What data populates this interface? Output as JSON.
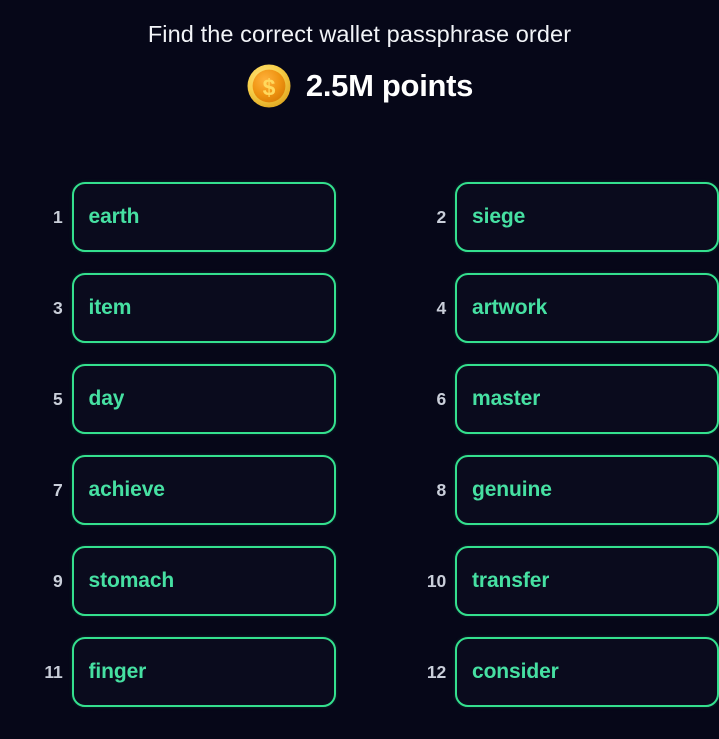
{
  "theme": {
    "background": "#060718",
    "box_border": "#34e08e",
    "box_fill": "#0a0b1d",
    "word_color": "#46e0a2",
    "index_color": "#c9ced9",
    "title_color": "#f2f4f8",
    "coin_outer": "#f7cf4a",
    "coin_inner": "#ef9412"
  },
  "header": {
    "title": "Find the correct wallet passphrase order",
    "coin_icon": "gold-coin-dollar-icon",
    "points": "2.5M points"
  },
  "grid": {
    "rows": [
      {
        "left": {
          "index": "1",
          "word": "earth"
        },
        "right": {
          "index": "2",
          "word": "siege"
        }
      },
      {
        "left": {
          "index": "3",
          "word": "item"
        },
        "right": {
          "index": "4",
          "word": "artwork"
        }
      },
      {
        "left": {
          "index": "5",
          "word": "day"
        },
        "right": {
          "index": "6",
          "word": "master"
        }
      },
      {
        "left": {
          "index": "7",
          "word": "achieve"
        },
        "right": {
          "index": "8",
          "word": "genuine"
        }
      },
      {
        "left": {
          "index": "9",
          "word": "stomach"
        },
        "right": {
          "index": "10",
          "word": "transfer"
        }
      },
      {
        "left": {
          "index": "11",
          "word": "finger"
        },
        "right": {
          "index": "12",
          "word": "consider"
        }
      }
    ]
  }
}
